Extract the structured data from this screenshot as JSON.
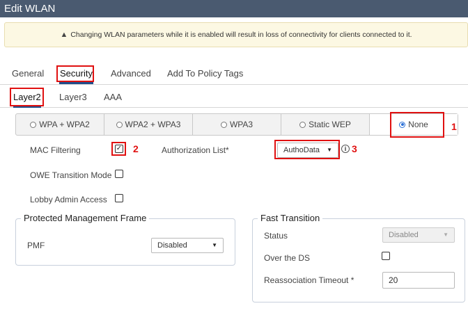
{
  "window": {
    "title": "Edit WLAN"
  },
  "warning": {
    "icon": "warning-triangle-icon",
    "text": "Changing WLAN parameters while it is enabled will result in loss of connectivity for clients connected to it."
  },
  "main_tabs": [
    {
      "label": "General",
      "active": false
    },
    {
      "label": "Security",
      "active": true
    },
    {
      "label": "Advanced",
      "active": false
    },
    {
      "label": "Add To Policy Tags",
      "active": false
    }
  ],
  "sub_tabs": [
    {
      "label": "Layer2",
      "active": true
    },
    {
      "label": "Layer3",
      "active": false
    },
    {
      "label": "AAA",
      "active": false
    }
  ],
  "security_modes": [
    {
      "label": "WPA + WPA2",
      "selected": false
    },
    {
      "label": "WPA2 + WPA3",
      "selected": false
    },
    {
      "label": "WPA3",
      "selected": false
    },
    {
      "label": "Static WEP",
      "selected": false
    },
    {
      "label": "None",
      "selected": true
    }
  ],
  "form": {
    "mac_filtering": {
      "label": "MAC Filtering",
      "checked": true
    },
    "owe_transition": {
      "label": "OWE Transition Mode",
      "checked": false
    },
    "lobby_admin": {
      "label": "Lobby Admin Access",
      "checked": false
    },
    "authorization_list": {
      "label": "Authorization List*",
      "value": "AuthoData",
      "info_icon": "info-icon"
    }
  },
  "pmf": {
    "legend": "Protected Management Frame",
    "label": "PMF",
    "value": "Disabled"
  },
  "fast_transition": {
    "legend": "Fast Transition",
    "status_label": "Status",
    "status_value": "Disabled",
    "over_ds_label": "Over the DS",
    "over_ds_checked": false,
    "reassoc_label": "Reassociation Timeout *",
    "reassoc_value": "20"
  },
  "annotations": [
    "1",
    "2",
    "3"
  ],
  "colors": {
    "titlebar": "#4a5a70",
    "accent": "#1f4e8c",
    "annotation": "#e01010",
    "warning_bg": "#fcf8e3"
  }
}
